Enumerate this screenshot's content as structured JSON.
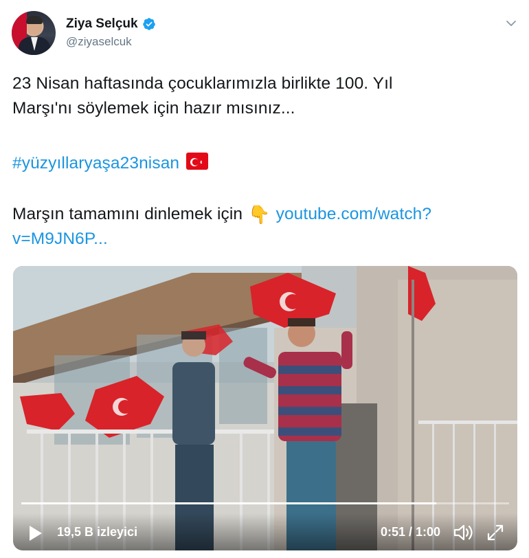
{
  "user": {
    "display_name": "Ziya Selçuk",
    "handle": "@ziyaselcuk",
    "verified": true
  },
  "tweet": {
    "line1": "23 Nisan haftasında çocuklarımızla birlikte 100. Yıl",
    "line2": "Marşı'nı söylemek için hazır mısınız...",
    "hashtag": "#yüzyıllaryaşa23nisan",
    "link_prefix": "Marşın tamamını dinlemek için",
    "link_part1": "youtube.com/watch?",
    "link_part2": "v=M9JN6P..."
  },
  "video": {
    "views": "19,5 B izleyici",
    "time": "0:51 / 1:00",
    "progress": 0.85
  },
  "icons": {
    "verified": "verified-badge-icon",
    "chevron": "chevron-down-icon",
    "flag": "turkish-flag-emoji",
    "pointing": "backhand-index-pointing-down-emoji",
    "play": "play-icon",
    "volume": "volume-icon",
    "fullscreen": "fullscreen-icon"
  },
  "colors": {
    "link": "#1b95e0",
    "text": "#14171a",
    "secondary": "#657786",
    "flag_red": "#e30a17"
  }
}
